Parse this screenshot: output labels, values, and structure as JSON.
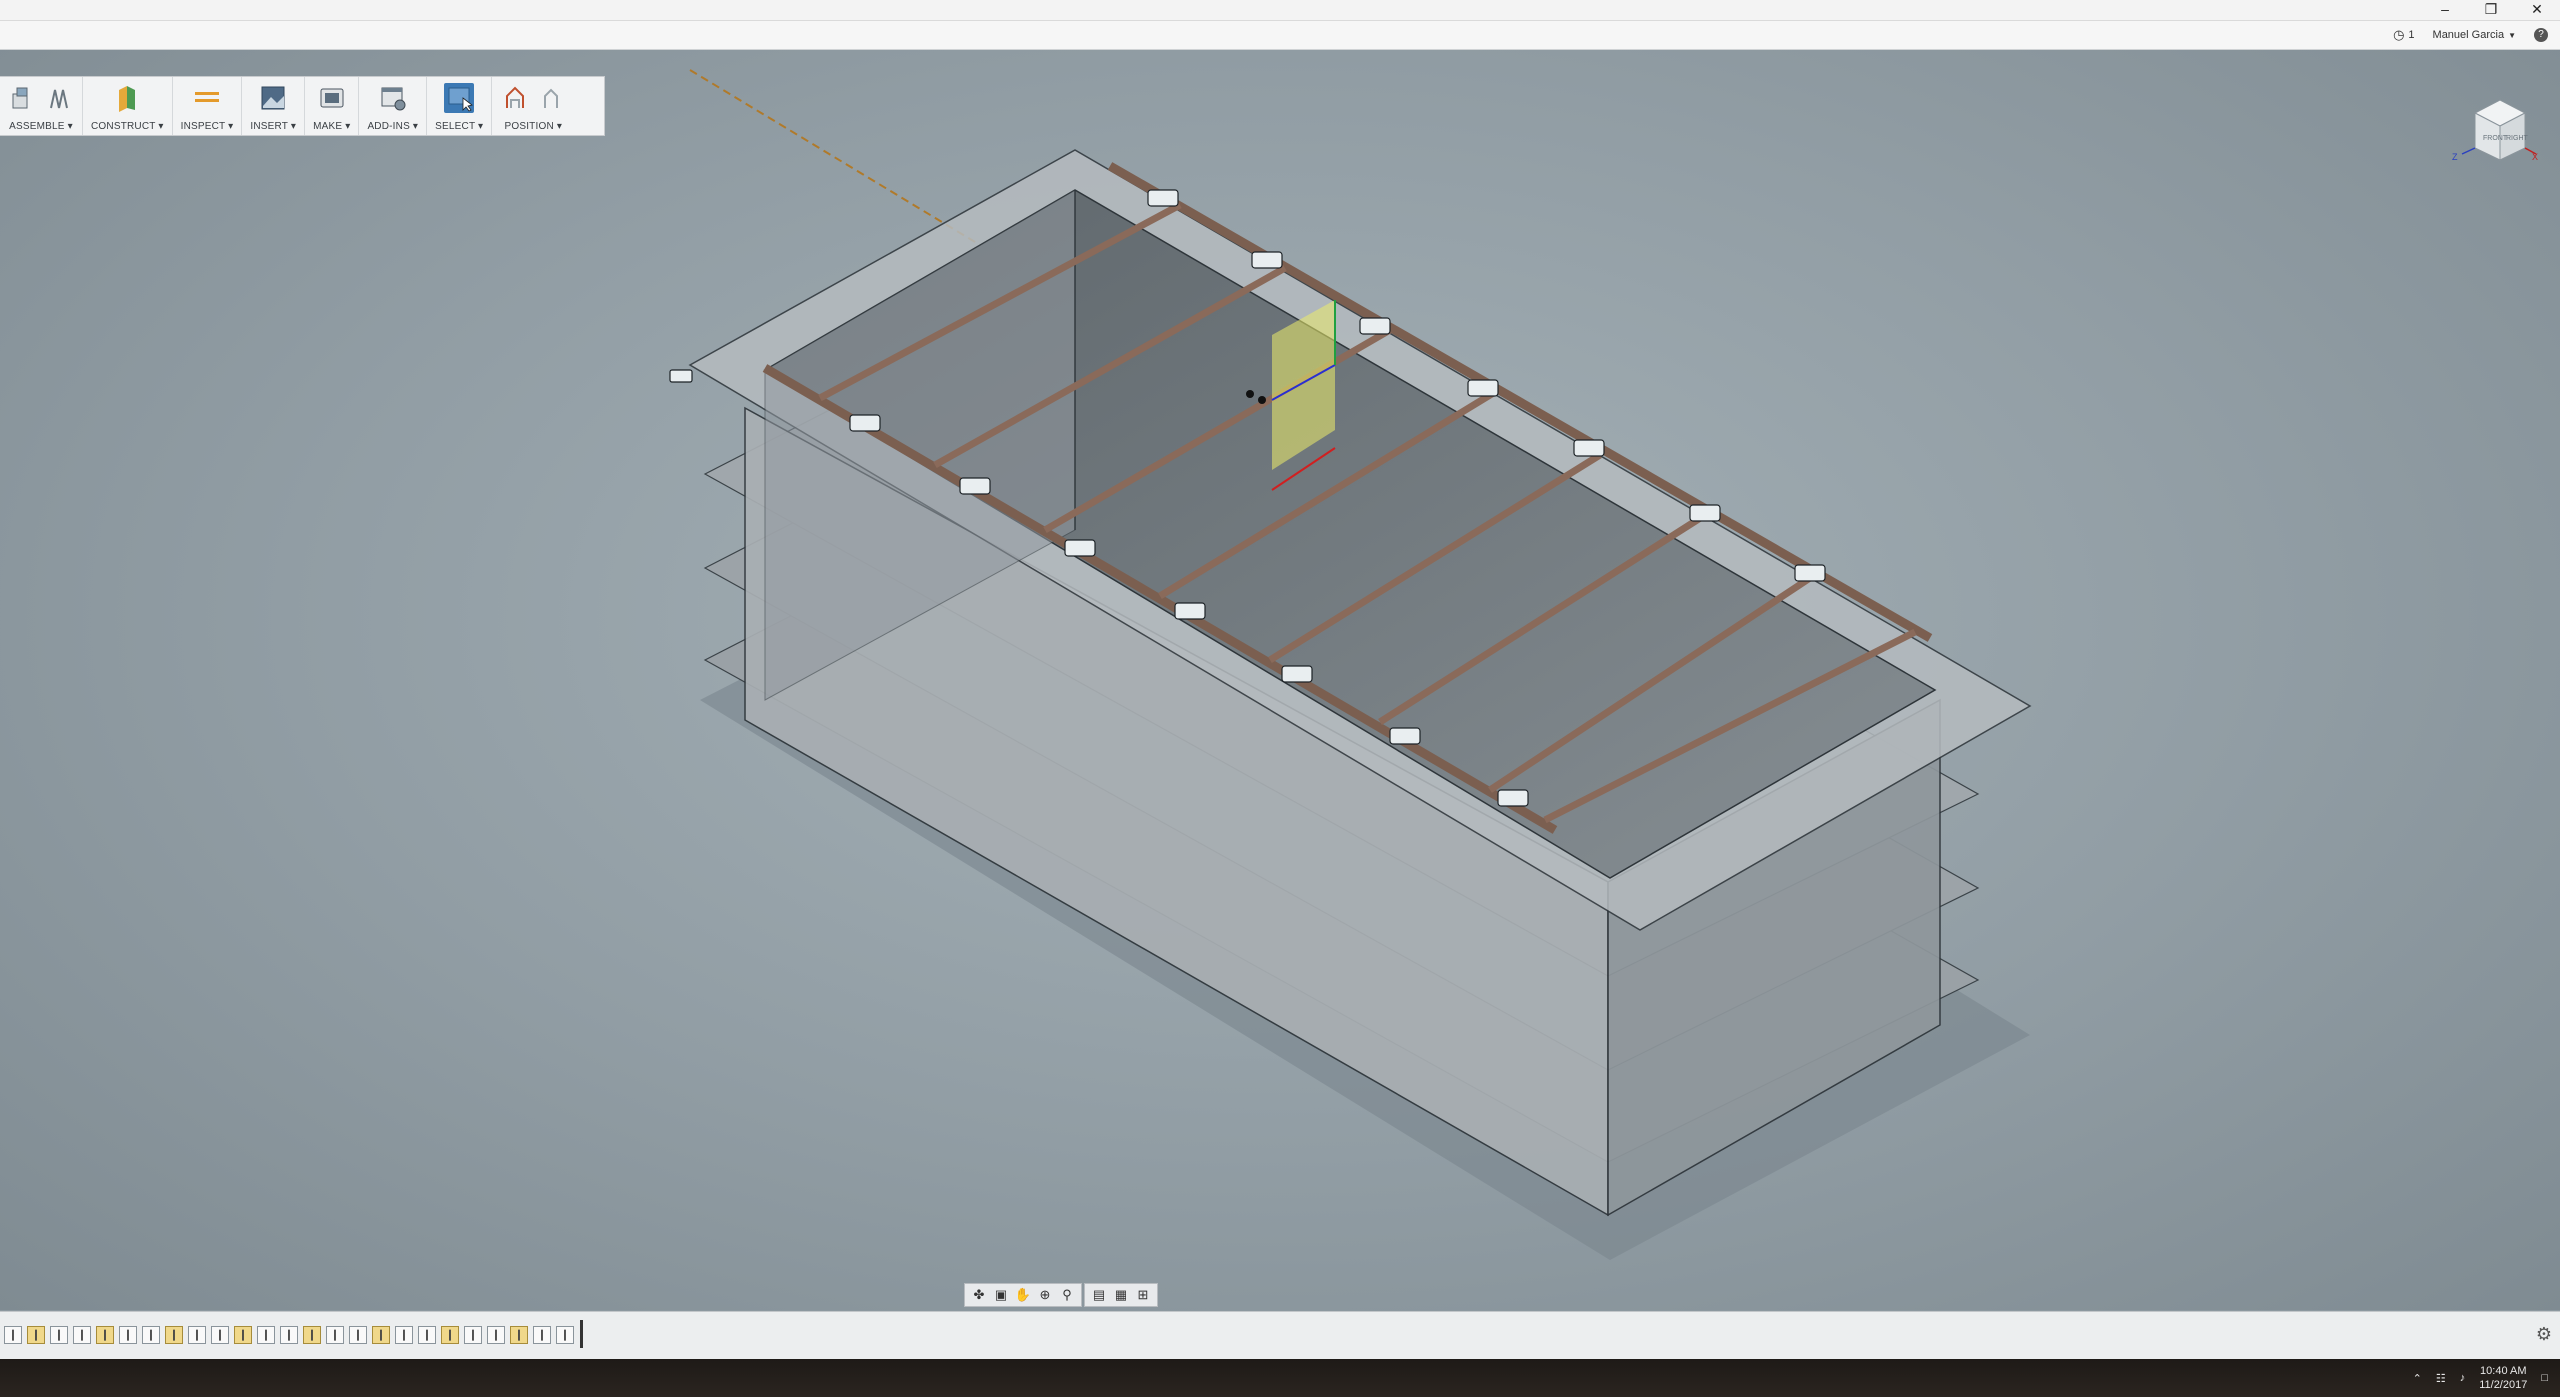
{
  "window": {
    "minimize_icon": "minimize-icon",
    "restore_icon": "restore-icon",
    "close_icon": "close-icon"
  },
  "appbar": {
    "job_count": "1",
    "user_name": "Manuel Garcia",
    "help_icon": "help-icon"
  },
  "toolbar": {
    "groups": [
      {
        "label": "ASSEMBLE"
      },
      {
        "label": "CONSTRUCT"
      },
      {
        "label": "INSPECT"
      },
      {
        "label": "INSERT"
      },
      {
        "label": "MAKE"
      },
      {
        "label": "ADD-INS"
      },
      {
        "label": "SELECT"
      },
      {
        "label": "POSITION"
      }
    ]
  },
  "viewcube": {
    "front_label": "FRONT",
    "right_label": "RIGHT",
    "axis_x": "X",
    "axis_z": "Z"
  },
  "navbar": {
    "tools": [
      "orbit",
      "look-at",
      "pan",
      "zoom",
      "zoom-window",
      "display-settings",
      "grid",
      "viewports"
    ]
  },
  "timeline": {
    "item_count": 25
  },
  "taskbar": {
    "time": "10:40 AM",
    "date": "11/2/2017"
  },
  "colors": {
    "viewport_bg": "#919da4",
    "accent": "#3c79b4",
    "rail": "#8a6a5a"
  }
}
